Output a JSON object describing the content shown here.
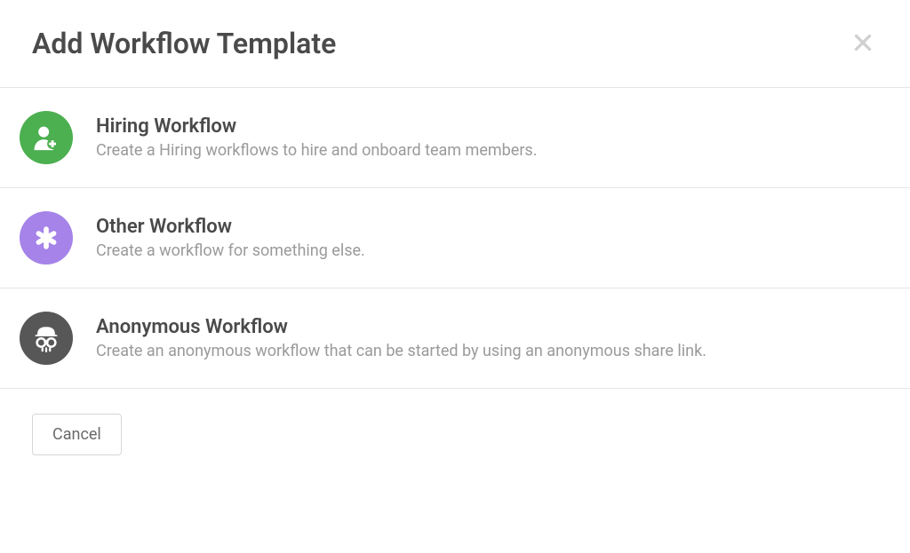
{
  "modal": {
    "title": "Add Workflow Template",
    "options": [
      {
        "title": "Hiring Workflow",
        "description": "Create a Hiring workflows to hire and onboard team members.",
        "icon": "user-plus-icon",
        "color": "#4caf50"
      },
      {
        "title": "Other Workflow",
        "description": "Create a workflow for something else.",
        "icon": "asterisk-icon",
        "color": "#a583e8"
      },
      {
        "title": "Anonymous Workflow",
        "description": "Create an anonymous workflow that can be started by using an anonymous share link.",
        "icon": "incognito-icon",
        "color": "#575757"
      }
    ],
    "cancel_label": "Cancel"
  }
}
